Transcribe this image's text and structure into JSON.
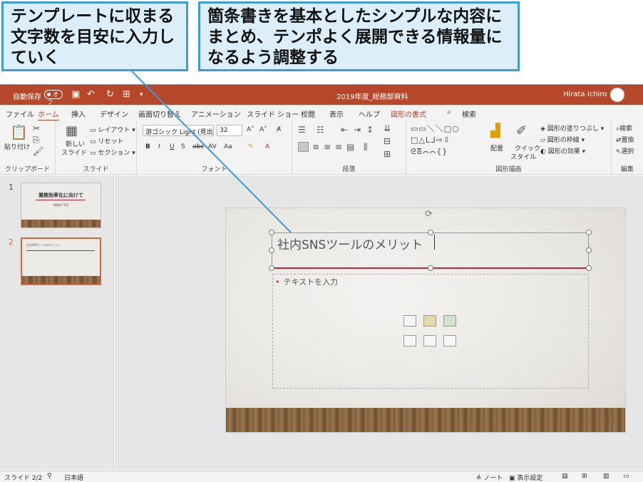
{
  "callouts": {
    "left": "テンプレートに収まる文字数を目安に入力していく",
    "right": "箇条書きを基本としたシンプルな内容にまとめ、テンポよく展開できる情報量になるよう調整する"
  },
  "window": {
    "autosave_label": "自動保存",
    "autosave_state": "オフ",
    "doc_title": "2019年度_総務部資料",
    "user_name": "Hirata Ichiro",
    "title_color": "#b7472a"
  },
  "tabs": [
    "ファイル",
    "ホーム",
    "挿入",
    "デザイン",
    "画面切り替え",
    "アニメーション",
    "スライド ショー",
    "校閲",
    "表示",
    "ヘルプ",
    "図形の書式"
  ],
  "search_label": "検索",
  "ribbon": {
    "clipboard": {
      "label": "クリップボード",
      "paste": "貼り付け"
    },
    "slides": {
      "label": "スライド",
      "new_slide_1": "新しい",
      "new_slide_2": "スライド",
      "layout": "レイアウト",
      "reset": "リセット",
      "section": "セクション"
    },
    "font": {
      "label": "フォント",
      "font_name": "游ゴシック Light (見出し",
      "font_size": "32",
      "case": "Aa"
    },
    "paragraph": {
      "label": "段落"
    },
    "drawing": {
      "label": "図形描画",
      "arrange": "配置",
      "quick_style_1": "クイック",
      "quick_style_2": "スタイル",
      "fill": "図形の塗りつぶし",
      "outline": "図形の枠線",
      "effects": "図形の効果"
    },
    "editing": {
      "label": "編集",
      "find": "検索",
      "replace": "置換",
      "select": "選択"
    }
  },
  "thumbnails": [
    {
      "number": "1",
      "title": "業務効率化に向けて",
      "subtitle": "総務部 平田"
    },
    {
      "number": "2",
      "title": "社内SNSツールのメリット"
    }
  ],
  "slide": {
    "title": "社内SNSツールのメリット",
    "content_placeholder": "テキストを入力"
  },
  "status": {
    "slide_counter": "スライド 2/2",
    "language": "日本語",
    "notes": "ノート",
    "display_settings": "表示設定"
  }
}
